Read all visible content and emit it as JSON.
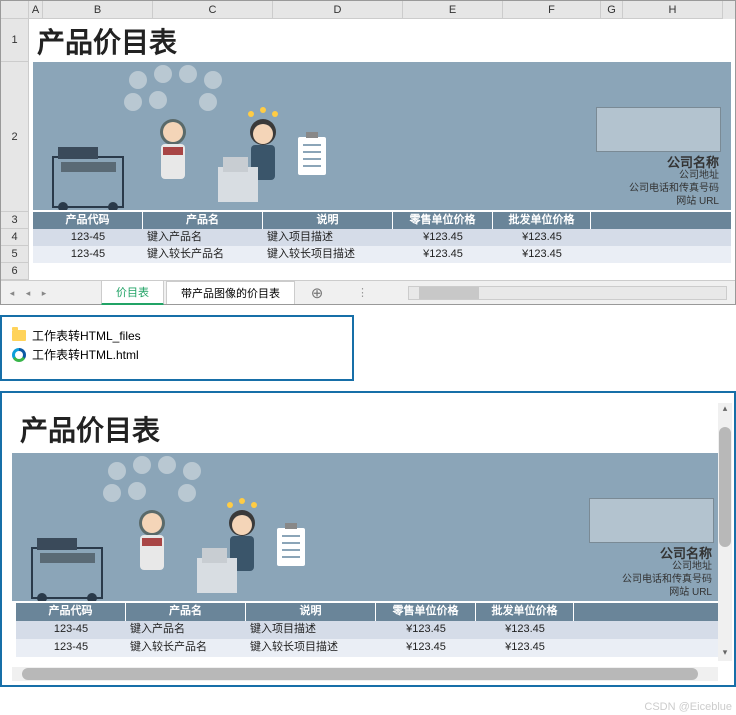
{
  "excel": {
    "columns": [
      "A",
      "B",
      "C",
      "D",
      "E",
      "F",
      "G",
      "H"
    ],
    "rows": [
      "1",
      "2",
      "3",
      "4",
      "5",
      "6"
    ],
    "title": "产品价目表",
    "company": {
      "name": "公司名称",
      "address": "公司地址",
      "phone_fax": "公司电话和传真号码",
      "website": "网站 URL"
    },
    "headers": {
      "c1": "产品代码",
      "c2": "产品名",
      "c3": "说明",
      "c4": "零售单位价格",
      "c5": "批发单位价格"
    },
    "rows_data": [
      {
        "code": "123-45",
        "name": "键入产品名",
        "desc": "键入项目描述",
        "retail": "¥123.45",
        "wholesale": "¥123.45"
      },
      {
        "code": "123-45",
        "name": "键入较长产品名",
        "desc": "键入较长项目描述",
        "retail": "¥123.45",
        "wholesale": "¥123.45"
      }
    ],
    "tabs": {
      "active": "价目表",
      "other": "带产品图像的价目表"
    }
  },
  "files": {
    "folder": "工作表转HTML_files",
    "html": "工作表转HTML.html"
  },
  "browser": {
    "title": "产品价目表",
    "company": {
      "name": "公司名称",
      "address": "公司地址",
      "phone_fax": "公司电话和传真号码",
      "website": "网站 URL"
    },
    "headers": {
      "c1": "产品代码",
      "c2": "产品名",
      "c3": "说明",
      "c4": "零售单位价格",
      "c5": "批发单位价格"
    },
    "rows_data": [
      {
        "code": "123-45",
        "name": "键入产品名",
        "desc": "键入项目描述",
        "retail": "¥123.45",
        "wholesale": "¥123.45"
      },
      {
        "code": "123-45",
        "name": "键入较长产品名",
        "desc": "键入较长项目描述",
        "retail": "¥123.45",
        "wholesale": "¥123.45"
      }
    ]
  },
  "watermark": "CSDN @Eiceblue"
}
